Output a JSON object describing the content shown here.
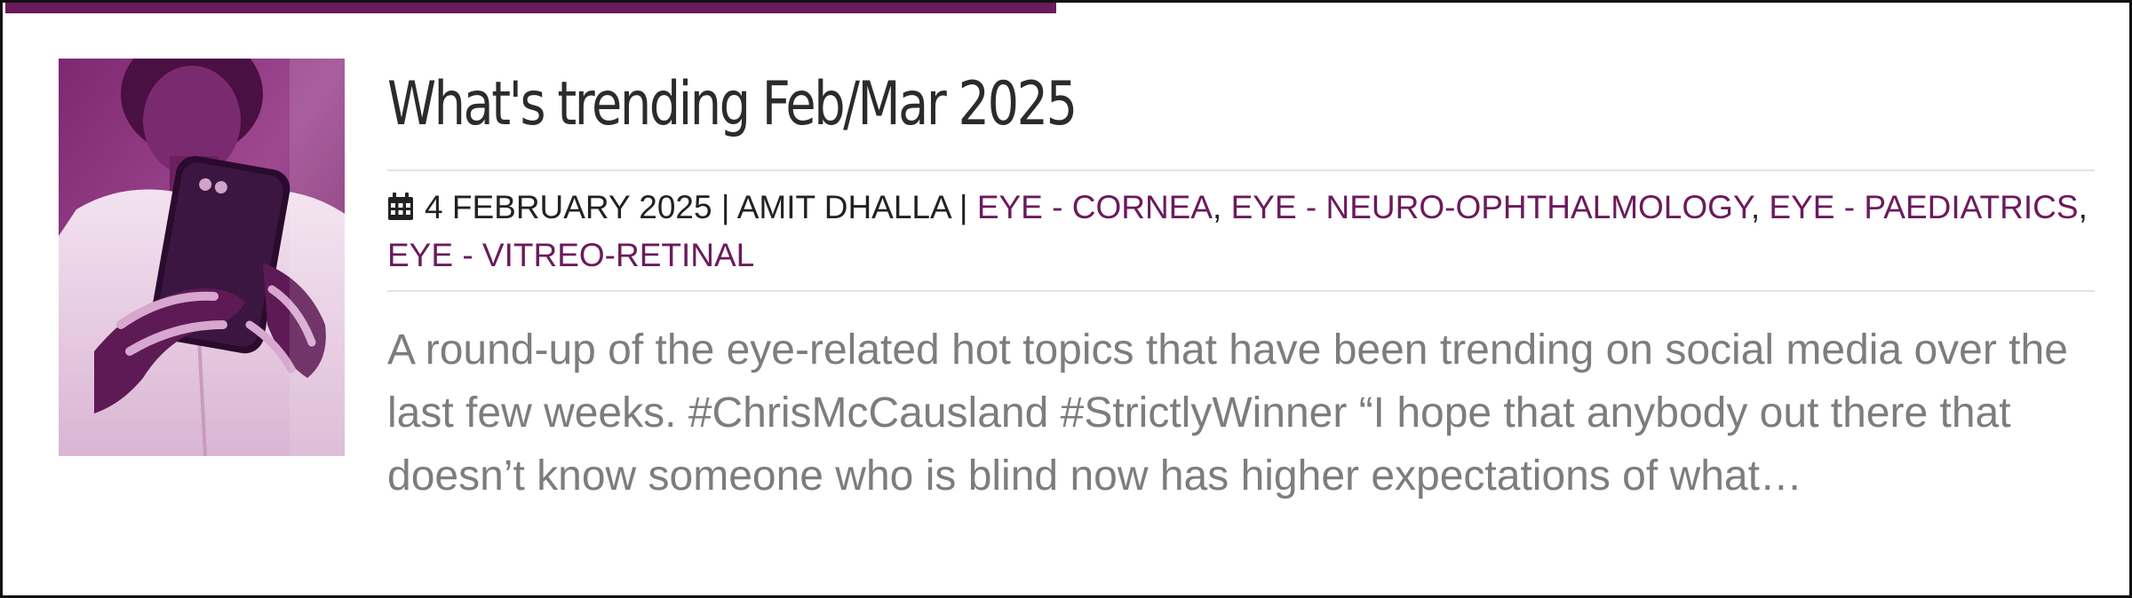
{
  "post": {
    "title": "What's trending Feb/Mar 2025",
    "date": "4 FEBRUARY 2025",
    "separator": " | ",
    "author": "AMIT DHALLA",
    "categories": [
      "EYE - CORNEA",
      "EYE - NEURO-OPHTHALMOLOGY",
      "EYE - PAEDIATRICS",
      "EYE - VITREO-RETINAL"
    ],
    "category_separator": ", ",
    "excerpt": "A round-up of the eye-related hot topics that have been trending on social media over the last few weeks. #ChrisMcCausland #StrictlyWinner “I hope that anybody out there that doesn’t know someone who is blind now has higher expectations of what…",
    "thumbnail_icon": "person-using-smartphone-photo",
    "meta_icon": "calendar-icon"
  },
  "colors": {
    "accent": "#6b1a5c",
    "title": "#2b2b2b",
    "meta_text": "#222222",
    "excerpt": "#7d7d7d",
    "rule": "#e3e3e3"
  }
}
